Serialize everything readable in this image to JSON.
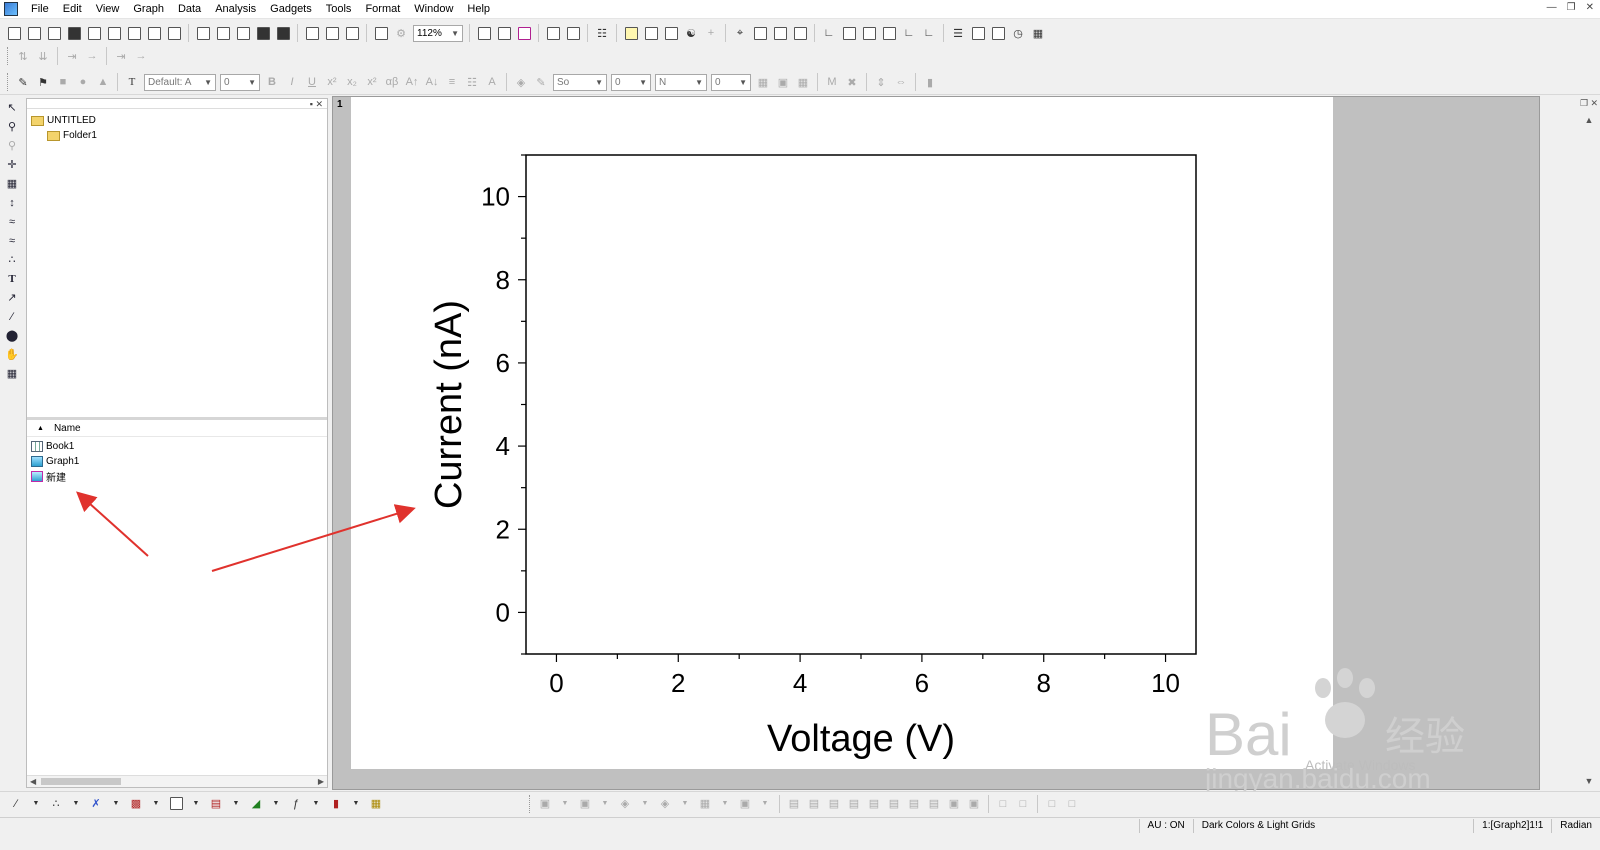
{
  "menu": {
    "items": [
      "File",
      "Edit",
      "View",
      "Graph",
      "Data",
      "Analysis",
      "Gadgets",
      "Tools",
      "Format",
      "Window",
      "Help"
    ]
  },
  "toolbar": {
    "zoom": "112%",
    "font_name": "Default: A",
    "font_size": "0",
    "line_style": "So",
    "line_width": "0",
    "fill_label": "N",
    "fill_size": "0"
  },
  "explorer": {
    "root": "UNTITLED",
    "folder": "Folder1",
    "list_header": "Name",
    "items": [
      "Book1",
      "Graph1",
      "新建"
    ]
  },
  "graph": {
    "layer_badge": "1"
  },
  "chart_data": {
    "type": "scatter",
    "series": [],
    "xlabel": "Voltage (V)",
    "ylabel": "Current (nA)",
    "xlim": [
      -0.5,
      10.5
    ],
    "ylim": [
      -1,
      11
    ],
    "xticks": [
      0,
      2,
      4,
      6,
      8,
      10
    ],
    "yticks": [
      0,
      2,
      4,
      6,
      8,
      10
    ],
    "xtick_labels": [
      "0",
      "2",
      "4",
      "6",
      "8",
      "10"
    ],
    "ytick_labels": [
      "0",
      "2",
      "4",
      "6",
      "8",
      "10"
    ],
    "grid": false
  },
  "watermark": {
    "brand": "Bai",
    "brand_suffix": "经验",
    "url": "jingyan.baidu.com",
    "activate": "Activate Windows"
  },
  "status": {
    "au": "AU : ON",
    "theme": "Dark Colors & Light Grids",
    "layer": "1:[Graph2]1!1",
    "angle": "Radian"
  },
  "colors": {
    "arrow": "#e0322d",
    "workspace": "#c0c0c0",
    "page": "#ffffff"
  }
}
